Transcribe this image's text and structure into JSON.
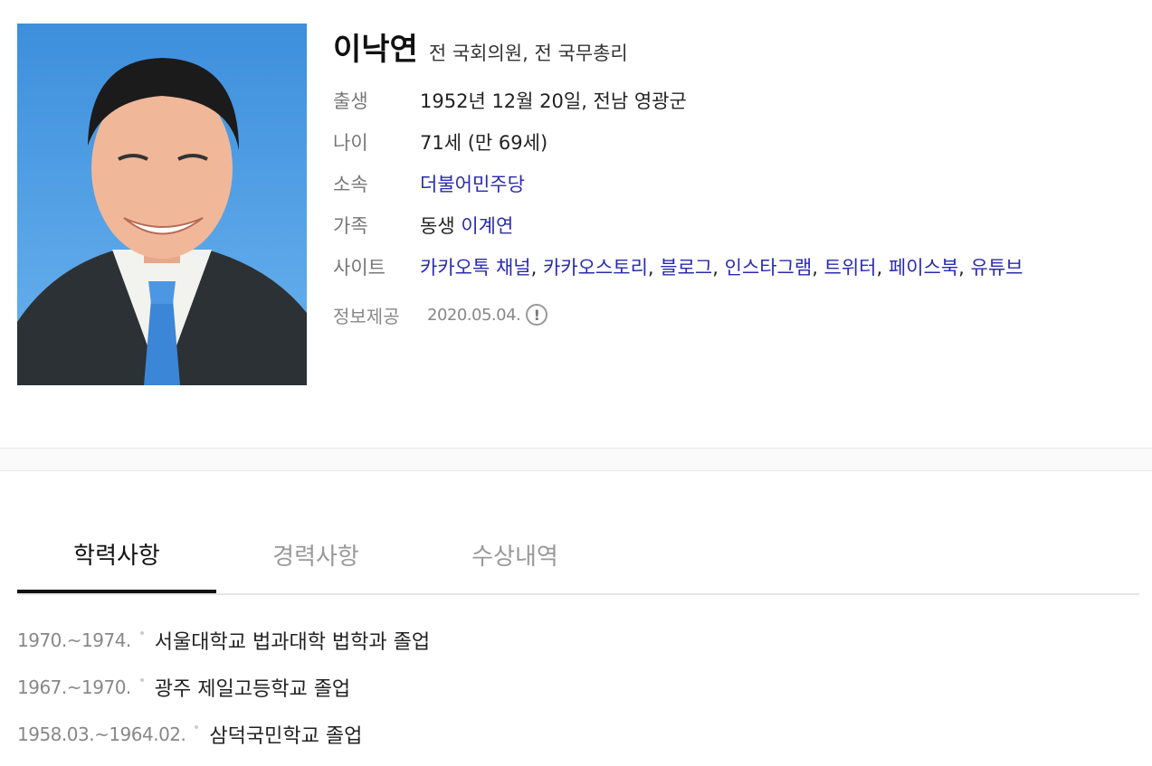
{
  "person": {
    "name": "이낙연",
    "subtitle": "전 국회의원, 전 국무총리"
  },
  "info": {
    "birth": {
      "label": "출생",
      "value": "1952년 12월 20일, 전남 영광군"
    },
    "age": {
      "label": "나이",
      "value": "71세 (만 69세)"
    },
    "party": {
      "label": "소속",
      "value": "더불어민주당"
    },
    "family": {
      "label": "가족",
      "relation": "동생",
      "name": "이계연"
    },
    "sites": {
      "label": "사이트",
      "links": [
        "카카오톡 채널",
        "카카오스토리",
        "블로그",
        "인스타그램",
        "트위터",
        "페이스북",
        "유튜브"
      ]
    },
    "source": {
      "label": "정보제공",
      "date": "2020.05.04."
    }
  },
  "tabs": [
    {
      "label": "학력사항",
      "active": true
    },
    {
      "label": "경력사항",
      "active": false
    },
    {
      "label": "수상내역",
      "active": false
    }
  ],
  "education": [
    {
      "period": "1970.~1974.",
      "desc": "서울대학교 법과대학 법학과 졸업"
    },
    {
      "period": "1967.~1970.",
      "desc": "광주 제일고등학교 졸업"
    },
    {
      "period": "1958.03.~1964.02.",
      "desc": "삼덕국민학교 졸업"
    }
  ],
  "colors": {
    "link": "#2a2ab1",
    "photo_background": "#4a9be0"
  },
  "icons": {
    "source_info": "exclamation-circle-icon"
  }
}
